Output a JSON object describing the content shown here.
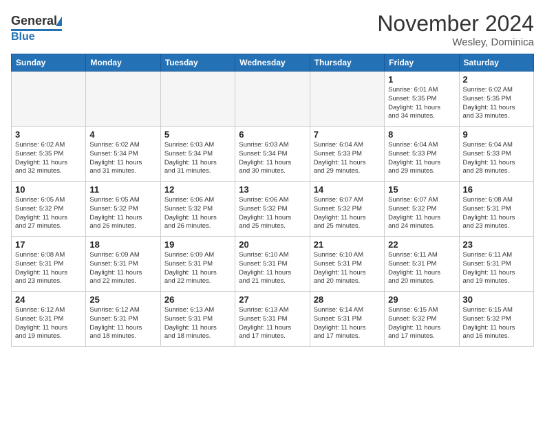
{
  "header": {
    "logo_general": "General",
    "logo_blue": "Blue",
    "month_title": "November 2024",
    "location": "Wesley, Dominica"
  },
  "days_of_week": [
    "Sunday",
    "Monday",
    "Tuesday",
    "Wednesday",
    "Thursday",
    "Friday",
    "Saturday"
  ],
  "weeks": [
    [
      {
        "day": "",
        "info": ""
      },
      {
        "day": "",
        "info": ""
      },
      {
        "day": "",
        "info": ""
      },
      {
        "day": "",
        "info": ""
      },
      {
        "day": "",
        "info": ""
      },
      {
        "day": "1",
        "info": "Sunrise: 6:01 AM\nSunset: 5:35 PM\nDaylight: 11 hours\nand 34 minutes."
      },
      {
        "day": "2",
        "info": "Sunrise: 6:02 AM\nSunset: 5:35 PM\nDaylight: 11 hours\nand 33 minutes."
      }
    ],
    [
      {
        "day": "3",
        "info": "Sunrise: 6:02 AM\nSunset: 5:35 PM\nDaylight: 11 hours\nand 32 minutes."
      },
      {
        "day": "4",
        "info": "Sunrise: 6:02 AM\nSunset: 5:34 PM\nDaylight: 11 hours\nand 31 minutes."
      },
      {
        "day": "5",
        "info": "Sunrise: 6:03 AM\nSunset: 5:34 PM\nDaylight: 11 hours\nand 31 minutes."
      },
      {
        "day": "6",
        "info": "Sunrise: 6:03 AM\nSunset: 5:34 PM\nDaylight: 11 hours\nand 30 minutes."
      },
      {
        "day": "7",
        "info": "Sunrise: 6:04 AM\nSunset: 5:33 PM\nDaylight: 11 hours\nand 29 minutes."
      },
      {
        "day": "8",
        "info": "Sunrise: 6:04 AM\nSunset: 5:33 PM\nDaylight: 11 hours\nand 29 minutes."
      },
      {
        "day": "9",
        "info": "Sunrise: 6:04 AM\nSunset: 5:33 PM\nDaylight: 11 hours\nand 28 minutes."
      }
    ],
    [
      {
        "day": "10",
        "info": "Sunrise: 6:05 AM\nSunset: 5:32 PM\nDaylight: 11 hours\nand 27 minutes."
      },
      {
        "day": "11",
        "info": "Sunrise: 6:05 AM\nSunset: 5:32 PM\nDaylight: 11 hours\nand 26 minutes."
      },
      {
        "day": "12",
        "info": "Sunrise: 6:06 AM\nSunset: 5:32 PM\nDaylight: 11 hours\nand 26 minutes."
      },
      {
        "day": "13",
        "info": "Sunrise: 6:06 AM\nSunset: 5:32 PM\nDaylight: 11 hours\nand 25 minutes."
      },
      {
        "day": "14",
        "info": "Sunrise: 6:07 AM\nSunset: 5:32 PM\nDaylight: 11 hours\nand 25 minutes."
      },
      {
        "day": "15",
        "info": "Sunrise: 6:07 AM\nSunset: 5:32 PM\nDaylight: 11 hours\nand 24 minutes."
      },
      {
        "day": "16",
        "info": "Sunrise: 6:08 AM\nSunset: 5:31 PM\nDaylight: 11 hours\nand 23 minutes."
      }
    ],
    [
      {
        "day": "17",
        "info": "Sunrise: 6:08 AM\nSunset: 5:31 PM\nDaylight: 11 hours\nand 23 minutes."
      },
      {
        "day": "18",
        "info": "Sunrise: 6:09 AM\nSunset: 5:31 PM\nDaylight: 11 hours\nand 22 minutes."
      },
      {
        "day": "19",
        "info": "Sunrise: 6:09 AM\nSunset: 5:31 PM\nDaylight: 11 hours\nand 22 minutes."
      },
      {
        "day": "20",
        "info": "Sunrise: 6:10 AM\nSunset: 5:31 PM\nDaylight: 11 hours\nand 21 minutes."
      },
      {
        "day": "21",
        "info": "Sunrise: 6:10 AM\nSunset: 5:31 PM\nDaylight: 11 hours\nand 20 minutes."
      },
      {
        "day": "22",
        "info": "Sunrise: 6:11 AM\nSunset: 5:31 PM\nDaylight: 11 hours\nand 20 minutes."
      },
      {
        "day": "23",
        "info": "Sunrise: 6:11 AM\nSunset: 5:31 PM\nDaylight: 11 hours\nand 19 minutes."
      }
    ],
    [
      {
        "day": "24",
        "info": "Sunrise: 6:12 AM\nSunset: 5:31 PM\nDaylight: 11 hours\nand 19 minutes."
      },
      {
        "day": "25",
        "info": "Sunrise: 6:12 AM\nSunset: 5:31 PM\nDaylight: 11 hours\nand 18 minutes."
      },
      {
        "day": "26",
        "info": "Sunrise: 6:13 AM\nSunset: 5:31 PM\nDaylight: 11 hours\nand 18 minutes."
      },
      {
        "day": "27",
        "info": "Sunrise: 6:13 AM\nSunset: 5:31 PM\nDaylight: 11 hours\nand 17 minutes."
      },
      {
        "day": "28",
        "info": "Sunrise: 6:14 AM\nSunset: 5:31 PM\nDaylight: 11 hours\nand 17 minutes."
      },
      {
        "day": "29",
        "info": "Sunrise: 6:15 AM\nSunset: 5:32 PM\nDaylight: 11 hours\nand 17 minutes."
      },
      {
        "day": "30",
        "info": "Sunrise: 6:15 AM\nSunset: 5:32 PM\nDaylight: 11 hours\nand 16 minutes."
      }
    ]
  ]
}
